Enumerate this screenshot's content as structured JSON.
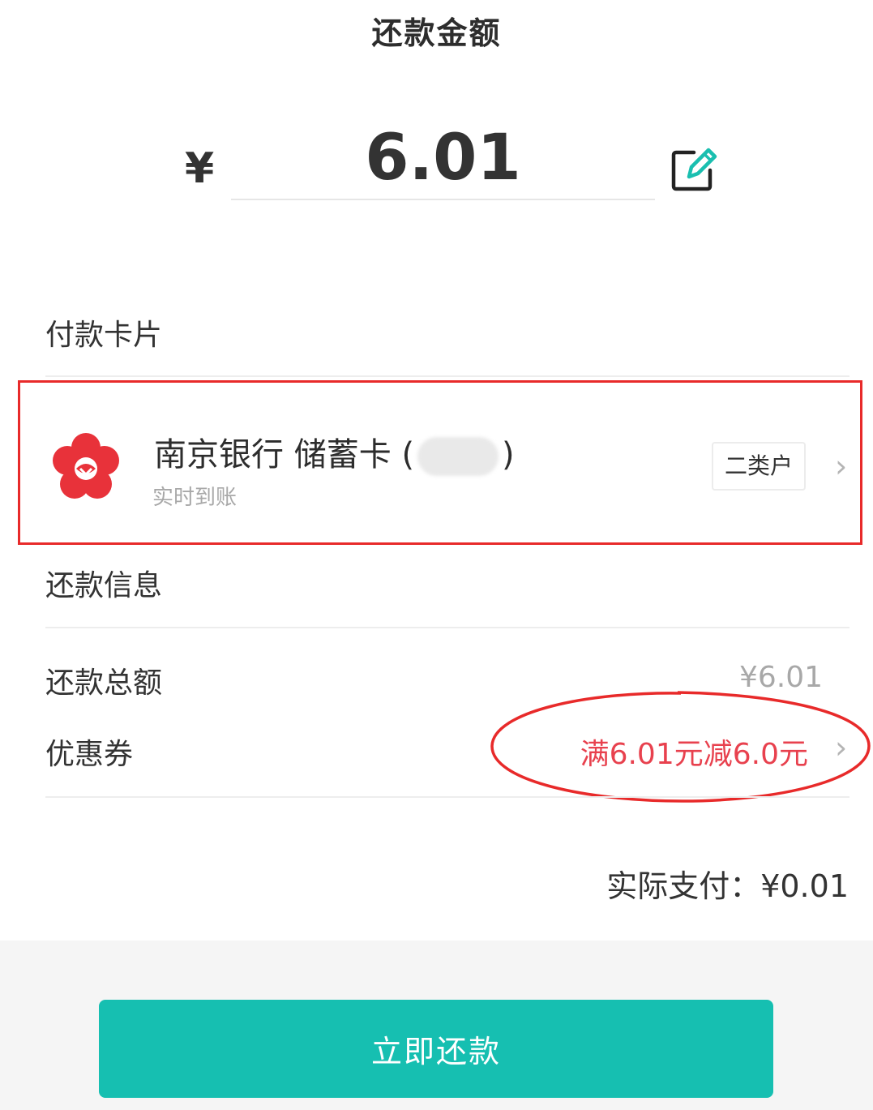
{
  "header": {
    "title": "还款金额"
  },
  "amount": {
    "currency_symbol": "¥",
    "value": "6.01"
  },
  "payment_card_section": {
    "title": "付款卡片"
  },
  "card": {
    "bank_name": "南京银行 储蓄卡",
    "open_paren": "(",
    "close_paren": ")",
    "subtitle": "实时到账",
    "account_type": "二类户"
  },
  "repayment_info": {
    "title": "还款信息",
    "total_label": "还款总额",
    "total_value": "¥6.01",
    "coupon_label": "优惠券",
    "coupon_value": "满6.01元减6.0元"
  },
  "actual_payment": {
    "text": "实际支付：¥0.01"
  },
  "actions": {
    "pay_now": "立即还款"
  },
  "colors": {
    "accent": "#16bfb1",
    "coupon_red": "#e8414e",
    "annotation_red": "#e82a2a",
    "bank_logo_red": "#e8323a"
  }
}
